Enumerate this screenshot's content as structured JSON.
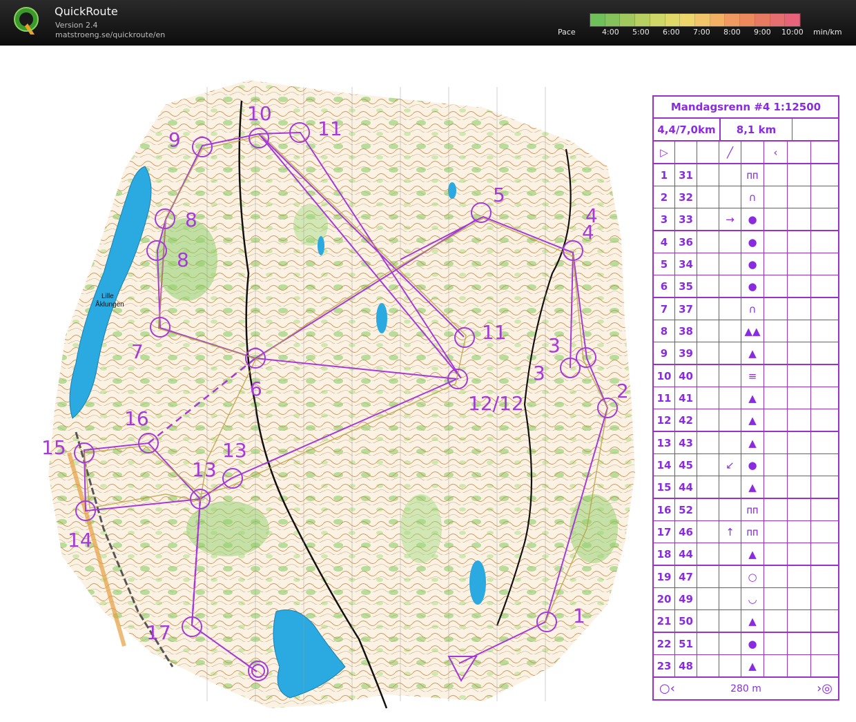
{
  "app": {
    "title": "QuickRoute",
    "version": "Version 2.4",
    "url": "matstroeng.se/quickroute/en"
  },
  "pace_legend": {
    "label": "Pace",
    "ticks": [
      "4:00",
      "5:00",
      "6:00",
      "7:00",
      "8:00",
      "9:00",
      "10:00"
    ],
    "unit": "min/km",
    "colors": [
      "#6fbf5a",
      "#86c25c",
      "#a0c85e",
      "#b8cf62",
      "#cfd766",
      "#e0d96a",
      "#eed66c",
      "#f3c56a",
      "#f2b064",
      "#ef9a60",
      "#ec8a5e",
      "#e87a62",
      "#e56f6f",
      "#e6637a"
    ]
  },
  "map": {
    "lake_label_line1": "Lille",
    "lake_label_line2": "Åklungen",
    "control_labels": [
      "10",
      "11",
      "9",
      "8",
      "8",
      "5",
      "4",
      "4",
      "7",
      "6",
      "11",
      "3",
      "3",
      "2",
      "12/12",
      "16",
      "15",
      "13",
      "13",
      "14",
      "17",
      "1"
    ],
    "course_color": "#a53ad6",
    "water_color": "#2aaae0"
  },
  "description_sheet": {
    "title": "Mandagsrenn #4 1:12500",
    "class": "4,4/7,0km",
    "length": "8,1 km",
    "start_row": [
      "▷",
      "",
      "",
      "╱",
      "",
      "‹",
      "",
      ""
    ],
    "controls": [
      {
        "n": "1",
        "code": "31",
        "dir": "",
        "sym": "ᴨᴨ"
      },
      {
        "n": "2",
        "code": "32",
        "dir": "",
        "sym": "∩"
      },
      {
        "n": "3",
        "code": "33",
        "dir": "→",
        "sym": "●"
      },
      {
        "n": "4",
        "code": "36",
        "dir": "",
        "sym": "●"
      },
      {
        "n": "5",
        "code": "34",
        "dir": "",
        "sym": "●"
      },
      {
        "n": "6",
        "code": "35",
        "dir": "",
        "sym": "●"
      },
      {
        "n": "7",
        "code": "37",
        "dir": "",
        "sym": "∩"
      },
      {
        "n": "8",
        "code": "38",
        "dir": "",
        "sym": "▲▲"
      },
      {
        "n": "9",
        "code": "39",
        "dir": "",
        "sym": "▲"
      },
      {
        "n": "10",
        "code": "40",
        "dir": "",
        "sym": "≡"
      },
      {
        "n": "11",
        "code": "41",
        "dir": "",
        "sym": "▲"
      },
      {
        "n": "12",
        "code": "42",
        "dir": "",
        "sym": "▲"
      },
      {
        "n": "13",
        "code": "43",
        "dir": "",
        "sym": "▲"
      },
      {
        "n": "14",
        "code": "45",
        "dir": "↙",
        "sym": "●"
      },
      {
        "n": "15",
        "code": "44",
        "dir": "",
        "sym": "▲"
      },
      {
        "n": "16",
        "code": "52",
        "dir": "",
        "sym": "ᴨᴨ"
      },
      {
        "n": "17",
        "code": "46",
        "dir": "↑",
        "sym": "ᴨᴨ"
      },
      {
        "n": "18",
        "code": "44",
        "dir": "",
        "sym": "▲"
      },
      {
        "n": "19",
        "code": "47",
        "dir": "",
        "sym": "○"
      },
      {
        "n": "20",
        "code": "49",
        "dir": "",
        "sym": "◡"
      },
      {
        "n": "21",
        "code": "50",
        "dir": "",
        "sym": "▲"
      },
      {
        "n": "22",
        "code": "51",
        "dir": "",
        "sym": "●"
      },
      {
        "n": "23",
        "code": "48",
        "dir": "",
        "sym": "▲"
      }
    ],
    "finish_distance": "280 m",
    "finish_left_symbol": "○‹",
    "finish_right_symbol": "›◎"
  }
}
